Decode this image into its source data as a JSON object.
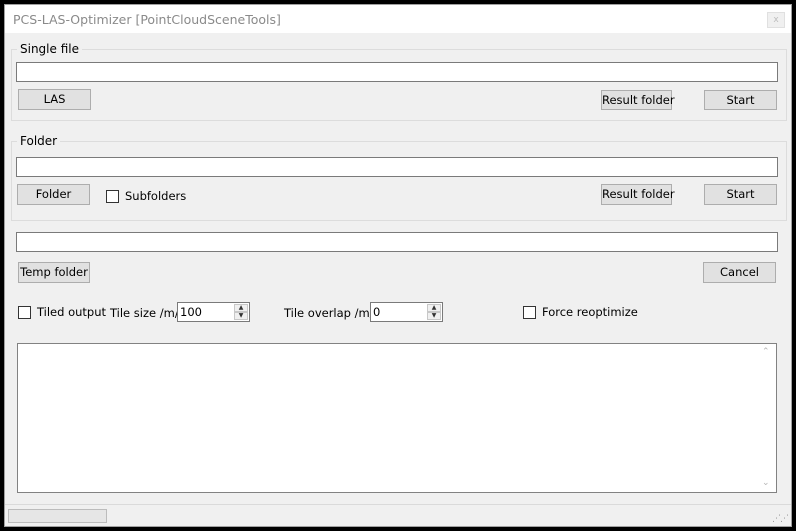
{
  "window": {
    "title": "PCS-LAS-Optimizer [PointCloudSceneTools]",
    "close_glyph": "x"
  },
  "single_file": {
    "group_label": "Single file",
    "path_value": "",
    "las_button": "LAS",
    "result_folder_button": "Result folder",
    "start_button": "Start"
  },
  "folder": {
    "group_label": "Folder",
    "path_value": "",
    "folder_button": "Folder",
    "subfolders_label": "Subfolders",
    "subfolders_checked": false,
    "result_folder_button": "Result folder",
    "start_button": "Start"
  },
  "temp": {
    "path_value": "",
    "temp_folder_button": "Temp folder",
    "cancel_button": "Cancel"
  },
  "options": {
    "tiled_output_label": "Tiled output",
    "tiled_output_checked": false,
    "tile_size_label": "Tile size /m/",
    "tile_size_value": "100",
    "tile_overlap_label": "Tile overlap /m/",
    "tile_overlap_value": "0",
    "force_reoptimize_label": "Force reoptimize",
    "force_reoptimize_checked": false
  },
  "log": {
    "content": ""
  },
  "status": {
    "progress": 0
  },
  "icons": {
    "spin_up": "▲",
    "spin_down": "▼",
    "scroll_up": "⌃",
    "scroll_down": "⌄",
    "grip": "⋰⋰"
  }
}
